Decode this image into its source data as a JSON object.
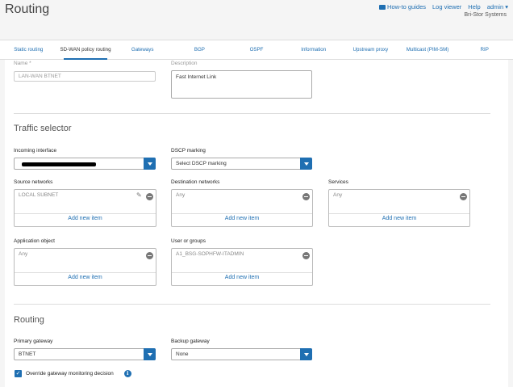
{
  "header": {
    "title": "Routing",
    "links": {
      "how_to": "How-to guides",
      "log_viewer": "Log viewer",
      "help": "Help",
      "admin": "admin ▾"
    },
    "company": "Bri-Stor Systems"
  },
  "tabs": [
    {
      "label": "Static routing"
    },
    {
      "label": "SD-WAN policy routing"
    },
    {
      "label": "Gateways"
    },
    {
      "label": "BGP"
    },
    {
      "label": "OSPF"
    },
    {
      "label": "Information"
    },
    {
      "label": "Upstream proxy"
    },
    {
      "label": "Multicast (PIM-SM)"
    },
    {
      "label": "RIP"
    }
  ],
  "form": {
    "name_label": "Name *",
    "name_value": "LAN-WAN BTNET",
    "description_label": "Description",
    "description_value": "Fast Internet Link",
    "traffic_selector_title": "Traffic selector",
    "incoming_interface_label": "Incoming interface",
    "dscp_label": "DSCP marking",
    "dscp_placeholder": "Select DSCP marking",
    "source_networks_label": "Source networks",
    "source_networks_item": "LOCAL SUBNET",
    "destination_networks_label": "Destination networks",
    "destination_networks_item": "Any",
    "services_label": "Services",
    "services_item": "Any",
    "application_object_label": "Application object",
    "application_object_item": "Any",
    "user_groups_label": "User or groups",
    "user_groups_item": "A1_BSG-SOPHFW-ITADMIN",
    "add_new_item": "Add new item",
    "routing_title": "Routing",
    "primary_gateway_label": "Primary gateway",
    "primary_gateway_value": "BTNET",
    "backup_gateway_label": "Backup gateway",
    "backup_gateway_value": "None",
    "override_label": "Override gateway monitoring decision"
  },
  "colors": {
    "accent": "#1f6fb2",
    "background": "#f5f5f5"
  },
  "icons": {
    "video": "video-icon",
    "remove": "remove-icon",
    "edit": "edit-icon",
    "dropdown": "chevron-down-icon",
    "info": "info-icon",
    "check": "check-icon"
  }
}
